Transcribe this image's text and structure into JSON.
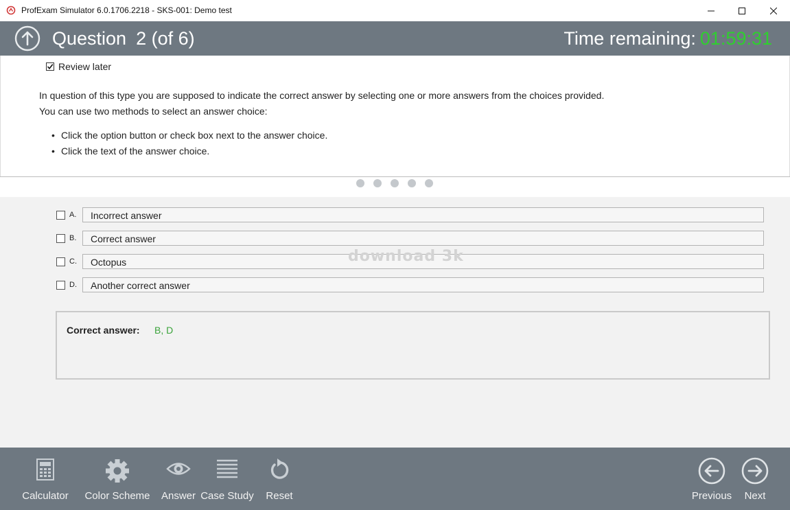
{
  "window": {
    "title": "ProfExam Simulator 6.0.1706.2218 - SKS-001: Demo test",
    "app_icon": "profexam-logo-icon",
    "controls": [
      "minimize-icon",
      "maximize-icon",
      "close-icon"
    ]
  },
  "header": {
    "question_label": "Question",
    "question_number": "2 (of 6)",
    "time_label": "Time remaining:",
    "time_value": "01:59:31",
    "time_color": "#2fcf2f",
    "up_icon": "arrow-up-circle-icon"
  },
  "question": {
    "review_later_label": "Review later",
    "review_later_checked": true,
    "text_line1": "In question of this type you are supposed to  indicate the correct answer by selecting one or more answers from the choices provided.",
    "text_line2": "You can use two methods to select an answer choice:",
    "bullets": [
      "Click the option button or check box next to the answer choice.",
      "Click the text of the answer choice."
    ]
  },
  "pager": {
    "dot_count": 5
  },
  "answers": [
    {
      "letter": "A.",
      "text": "Incorrect answer",
      "checked": false
    },
    {
      "letter": "B.",
      "text": "Correct answer",
      "checked": false
    },
    {
      "letter": "C.",
      "text": "Octopus",
      "checked": false
    },
    {
      "letter": "D.",
      "text": "Another correct answer",
      "checked": false
    }
  ],
  "watermark": "download 3k",
  "result": {
    "label": "Correct answer:",
    "value": "B, D",
    "value_color": "#3aa33a"
  },
  "toolbar": {
    "calculator": {
      "label": "Calculator",
      "icon": "calculator-icon"
    },
    "color_scheme": {
      "label": "Color Scheme",
      "icon": "gear-icon"
    },
    "answer": {
      "label": "Answer",
      "icon": "eye-icon"
    },
    "case_study": {
      "label": "Case Study",
      "icon": "lines-icon"
    },
    "reset": {
      "label": "Reset",
      "icon": "reset-icon"
    },
    "previous": {
      "label": "Previous",
      "icon": "arrow-left-circle-icon"
    },
    "next": {
      "label": "Next",
      "icon": "arrow-right-circle-icon"
    }
  },
  "colors": {
    "header_bg": "#6e7881",
    "toolbar_bg": "#6e7881",
    "answers_bg": "#f2f2f2"
  }
}
